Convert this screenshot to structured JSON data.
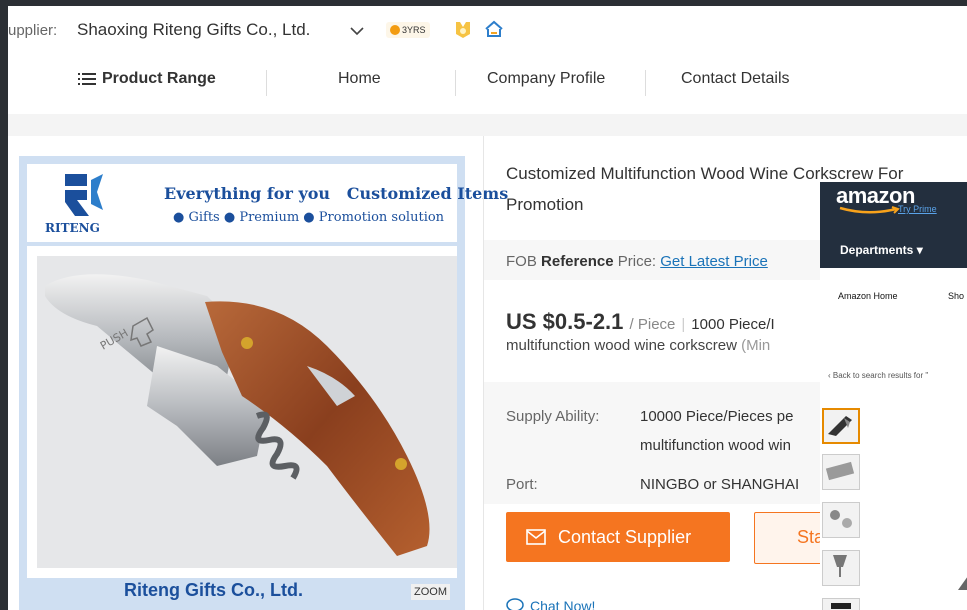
{
  "supplier": {
    "label": "upplier:",
    "name": "Shaoxing Riteng Gifts Co., Ltd.",
    "years_badge": "3YRS",
    "icons": [
      "chevron-down-icon",
      "medal-icon",
      "house-icon"
    ]
  },
  "nav": {
    "product_range": "Product Range",
    "home": "Home",
    "company_profile": "Company Profile",
    "contact_details": "Contact Details"
  },
  "product_image": {
    "logo_text": "RITENG",
    "slogan_line1": "Everything for you   Customized Items",
    "slogan_line2": "● Gifts ● Premium ● Promotion solution",
    "footer_company": "Riteng Gifts Co., Ltd.",
    "zoom_label": "ZOOM",
    "engraving": "PUSH"
  },
  "product": {
    "title": "Customized Multifunction Wood Wine Corkscrew For Promotion",
    "fob_prefix": "FOB",
    "fob_bold": "Reference",
    "fob_suffix": "Price:",
    "fob_link": "Get Latest Price",
    "price": "US $0.5-2.1",
    "price_unit": "/ Piece",
    "moq": "1000 Piece/I",
    "product_name": "multifunction wood wine corkscrew",
    "product_name_min": "(Min"
  },
  "specs": {
    "supply_label": "Supply Ability:",
    "supply_value_1": "10000 Piece/Pieces pe",
    "supply_value_2": "multifunction wood win",
    "port_label": "Port:",
    "port_value": "NINGBO or SHANGHAI"
  },
  "actions": {
    "contact_supplier": "Contact Supplier",
    "start_partial": "Sta",
    "chat_now": "Chat Now!"
  },
  "amazon_overlay": {
    "logo": "amazon",
    "try_prime": "Try Prime",
    "departments": "Departments ▾",
    "amazon_home": "Amazon Home",
    "sho_partial": "Sho",
    "back_link": "‹ Back to search results for \""
  },
  "colors": {
    "accent_orange": "#f57520",
    "link_blue": "#1a73b8",
    "brand_blue": "#1b4f9c",
    "amazon_dark": "#232f3e"
  }
}
